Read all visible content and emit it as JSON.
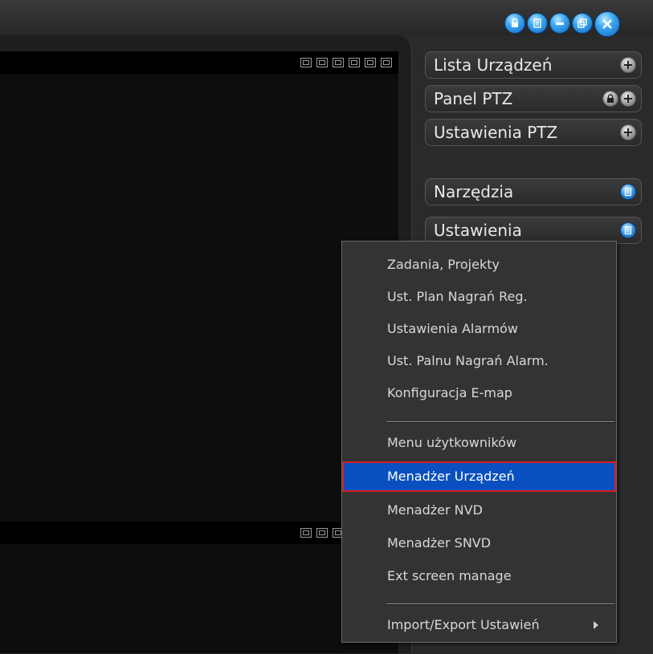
{
  "window": {
    "controls": [
      {
        "name": "lock-icon"
      },
      {
        "name": "list-icon"
      },
      {
        "name": "minimize-icon"
      },
      {
        "name": "restore-icon"
      },
      {
        "name": "close-icon"
      }
    ]
  },
  "sidebar": {
    "items": [
      {
        "label": "Lista Urządzeń",
        "buttons": [
          "plus-icon"
        ]
      },
      {
        "label": "Panel PTZ",
        "buttons": [
          "lock-icon",
          "plus-icon"
        ]
      },
      {
        "label": "Ustawienia PTZ",
        "buttons": [
          "plus-icon"
        ]
      },
      {
        "label": "Narzędzia",
        "buttons": [
          "list-icon"
        ]
      },
      {
        "label": "Ustawienia",
        "buttons": [
          "list-icon"
        ]
      }
    ]
  },
  "context_menu": {
    "items": [
      {
        "label": "Zadania, Projekty"
      },
      {
        "label": "Ust. Plan Nagrań Reg."
      },
      {
        "label": "Ustawienia Alarmów"
      },
      {
        "label": "Ust. Palnu Nagrań Alarm."
      },
      {
        "label": "Konfiguracja E-map"
      },
      {
        "label": "Menu użytkowników"
      },
      {
        "label": "Menadżer Urządzeń",
        "selected": true
      },
      {
        "label": "Menadżer NVD"
      },
      {
        "label": "Menadżer SNVD"
      },
      {
        "label": "Ext screen manage"
      },
      {
        "label": "Import/Export Ustawień",
        "has_submenu": true
      }
    ]
  },
  "colors": {
    "accent": "#0a4fbf",
    "highlight_border": "#d61f1f",
    "button_blue": "#2f8fe0"
  }
}
